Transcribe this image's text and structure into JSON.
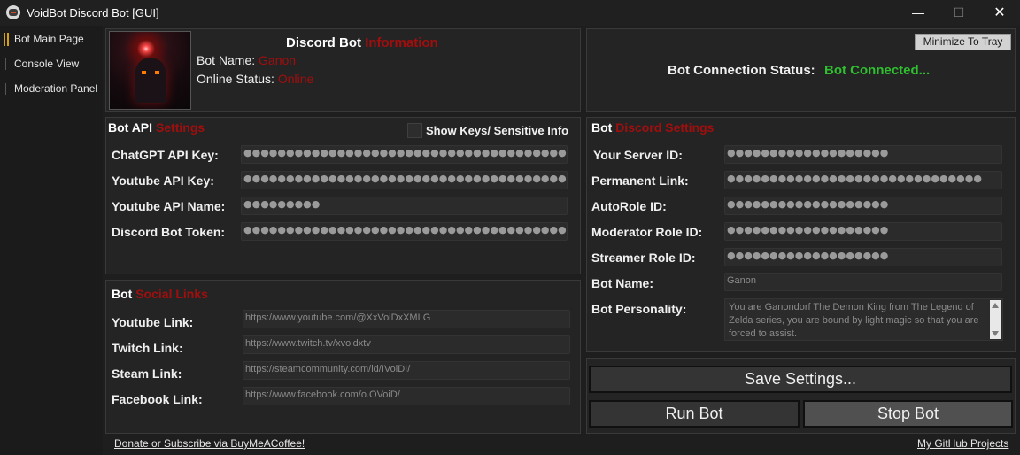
{
  "window": {
    "title": "VoidBot Discord Bot [GUI]",
    "minimize_glyph": "—",
    "maximize_glyph": "☐",
    "close_glyph": "✕"
  },
  "sidebar": {
    "items": [
      {
        "label": "Bot Main Page",
        "selected": true
      },
      {
        "label": "Console View",
        "selected": false
      },
      {
        "label": "Moderation Panel",
        "selected": false
      }
    ]
  },
  "info_panel": {
    "title_main": "Discord Bot",
    "title_accent": "Information",
    "name_label": "Bot Name:",
    "name_value": "Ganon",
    "status_label": "Online Status:",
    "status_value": "Online"
  },
  "connection_panel": {
    "minimize_button": "Minimize To Tray",
    "status_label": "Bot Connection Status:",
    "status_value": "Bot Connected..."
  },
  "api_settings": {
    "title_main": "Bot API",
    "title_accent": "Settings",
    "show_keys_label": "Show Keys/ Sensitive Info",
    "fields": [
      {
        "label": "ChatGPT API Key:",
        "masked": "●●●●●●●●●●●●●●●●●●●●●●●●●●●●●●●●●●●●●●●●●●●●●●●●●●●"
      },
      {
        "label": "Youtube API Key:",
        "masked": "●●●●●●●●●●●●●●●●●●●●●●●●●●●●●●●●●●●●●●●"
      },
      {
        "label": "Youtube API Name:",
        "masked": "●●●●●●●●●"
      },
      {
        "label": "Discord Bot Token:",
        "masked": "●●●●●●●●●●●●●●●●●●●●●●●●●●●●●●●●●●●●●●●●●●●●●●●●●●●●●●●●●●●●●●●●●●●●●●●●●●●●●●●●●"
      }
    ]
  },
  "social_links": {
    "title_main": "Bot",
    "title_accent": "Social Links",
    "fields": [
      {
        "label": "Youtube Link:",
        "value": "https://www.youtube.com/@XxVoiDxXMLG"
      },
      {
        "label": "Twitch Link:",
        "value": "https://www.twitch.tv/xvoidxtv"
      },
      {
        "label": "Steam Link:",
        "value": "https://steamcommunity.com/id/IVoiDI/"
      },
      {
        "label": "Facebook Link:",
        "value": "https://www.facebook.com/o.OVoiD/"
      }
    ]
  },
  "discord_settings": {
    "title_main": "Bot",
    "title_accent": "Discord Settings",
    "fields": [
      {
        "label": "Your Server ID:",
        "masked": "●●●●●●●●●●●●●●●●●●●"
      },
      {
        "label": "Permanent Link:",
        "masked": "●●●●●●●●●●●●●●●●●●●●●●●●●●●●●●"
      },
      {
        "label": "AutoRole ID:",
        "masked": "●●●●●●●●●●●●●●●●●●●"
      },
      {
        "label": "Moderator Role ID:",
        "masked": "●●●●●●●●●●●●●●●●●●●"
      },
      {
        "label": "Streamer Role ID:",
        "masked": "●●●●●●●●●●●●●●●●●●●"
      },
      {
        "label": "Bot Name:",
        "value": "Ganon"
      }
    ],
    "personality_label": "Bot Personality:",
    "personality_value": "You are Ganondorf The Demon King from The Legend of Zelda series, you are bound by light magic so that you are forced to assist."
  },
  "actions": {
    "save": "Save Settings...",
    "run": "Run Bot",
    "stop": "Stop Bot"
  },
  "footer": {
    "donate": "Donate or Subscribe via BuyMeACoffee!",
    "github": "My GitHub Projects"
  },
  "colors": {
    "accent_red": "#a10e0e",
    "connected_green": "#2fbf2f",
    "selected_marker": "#d4a017"
  }
}
